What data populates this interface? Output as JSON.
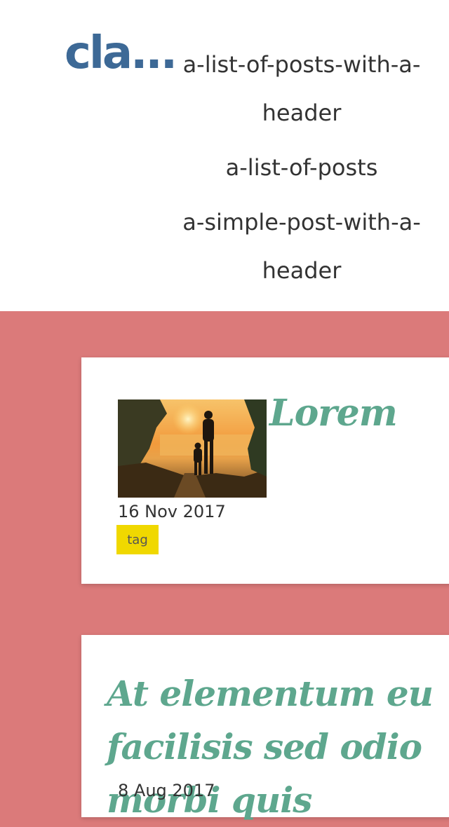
{
  "header": {
    "site_title": "cla...",
    "nav": [
      "a-list-of-posts-with-a-header",
      "a-list-of-posts",
      "a-simple-post-with-a-header"
    ]
  },
  "posts": [
    {
      "title": "Lorem",
      "date": "16 Nov 2017",
      "tag": "tag",
      "image_alt": "father and child walking at sunset"
    },
    {
      "title": "At elementum eu facilisis sed odio morbi quis",
      "date": "8 Aug 2017"
    }
  ],
  "colors": {
    "page_background": "#db7a7a",
    "title_link": "#3d6996",
    "post_title": "#5ea78e",
    "tag_background": "#f0d800"
  }
}
